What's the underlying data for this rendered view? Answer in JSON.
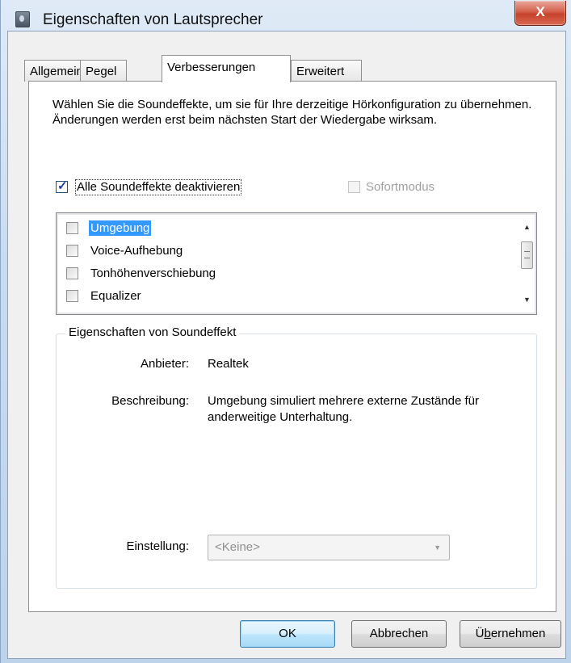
{
  "window": {
    "title": "Eigenschaften von Lautsprecher",
    "close_label": "X"
  },
  "tabs": [
    {
      "label": "Allgemein",
      "active": false
    },
    {
      "label": "Pegel",
      "active": false
    },
    {
      "label": "Verbesserungen",
      "active": true
    },
    {
      "label": "Erweitert",
      "active": false
    }
  ],
  "panel": {
    "intro_text": "Wählen Sie die Soundeffekte, um sie für Ihre derzeitige Hörkonfiguration zu übernehmen. Änderungen werden erst beim nächsten Start der Wiedergabe wirksam.",
    "disable_all": {
      "label": "Alle Soundeffekte deaktivieren",
      "checked": true
    },
    "immediate_mode": {
      "label": "Sofortmodus",
      "checked": false,
      "enabled": false
    },
    "effects": [
      {
        "label": "Umgebung",
        "checked": false,
        "selected": true
      },
      {
        "label": "Voice-Aufhebung",
        "checked": false,
        "selected": false
      },
      {
        "label": "Tonhöhenverschiebung",
        "checked": false,
        "selected": false
      },
      {
        "label": "Equalizer",
        "checked": false,
        "selected": false
      }
    ],
    "properties": {
      "group_title": "Eigenschaften von Soundeffekt",
      "provider_label": "Anbieter:",
      "provider_value": "Realtek",
      "description_label": "Beschreibung:",
      "description_value": "Umgebung simuliert mehrere externe Zustände für anderweitige Unterhaltung.",
      "setting_label": "Einstellung:",
      "setting_value": "<Keine>"
    }
  },
  "buttons": {
    "ok": "OK",
    "cancel": "Abbrechen",
    "apply_prefix": "Ü",
    "apply_underlined": "b",
    "apply_suffix": "ernehmen"
  }
}
